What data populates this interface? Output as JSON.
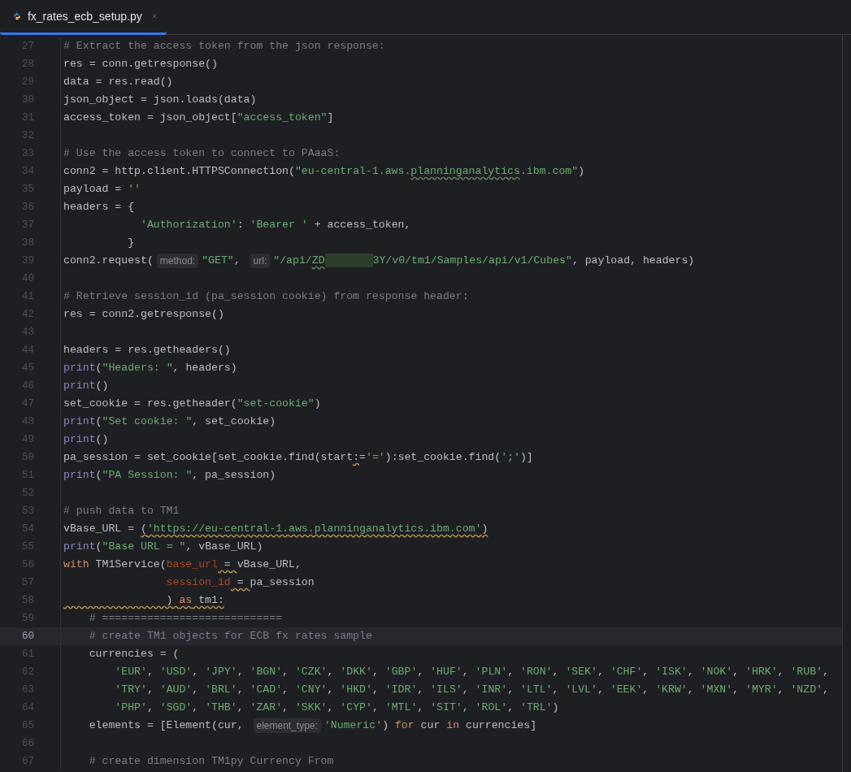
{
  "tab": {
    "title": "fx_rates_ecb_setup.py",
    "selected": true
  },
  "lines": [
    {
      "number": "27",
      "current": false,
      "tokens": [
        {
          "kind": "comment",
          "text": "# Extract the access token from the json response:"
        }
      ]
    },
    {
      "number": "28",
      "current": false,
      "tokens": [
        {
          "kind": "plain",
          "text": "res = conn.getresponse()"
        }
      ]
    },
    {
      "number": "29",
      "current": false,
      "tokens": [
        {
          "kind": "plain",
          "text": "data = res.read()"
        }
      ]
    },
    {
      "number": "30",
      "current": false,
      "tokens": [
        {
          "kind": "plain",
          "text": "json_object = json.loads(data)"
        }
      ]
    },
    {
      "number": "31",
      "current": false,
      "tokens": [
        {
          "kind": "plain",
          "text": "access_token = json_object["
        },
        {
          "kind": "string",
          "text": "\"access_token\""
        },
        {
          "kind": "plain",
          "text": "]"
        }
      ]
    },
    {
      "number": "32",
      "current": false
    },
    {
      "number": "33",
      "current": false,
      "tokens": [
        {
          "kind": "comment",
          "text": "# Use the access token to connect to PAaaS:"
        }
      ]
    },
    {
      "number": "34",
      "current": false,
      "tokens": [
        {
          "kind": "plain",
          "text": "conn2 = http.client.HTTPSConnection("
        },
        {
          "kind": "string",
          "text": "\"eu-central-1.aws."
        },
        {
          "kind": "string",
          "text": "planninganalytics",
          "misspelled": true
        },
        {
          "kind": "string",
          "text": ".ibm.com\""
        },
        {
          "kind": "plain",
          "text": ")"
        }
      ]
    },
    {
      "number": "35",
      "current": false,
      "tokens": [
        {
          "kind": "plain",
          "text": "payload = "
        },
        {
          "kind": "string",
          "text": "''"
        }
      ]
    },
    {
      "number": "36",
      "current": false,
      "tokens": [
        {
          "kind": "plain",
          "text": "headers = {"
        }
      ]
    },
    {
      "number": "37",
      "current": false,
      "tokens": [
        {
          "kind": "string",
          "text": "            'Authorization'"
        },
        {
          "kind": "plain",
          "text": ": "
        },
        {
          "kind": "string",
          "text": "'Bearer '"
        },
        {
          "kind": "plain",
          "text": " + access_token,"
        }
      ]
    },
    {
      "number": "38",
      "current": false,
      "tokens": [
        {
          "kind": "plain",
          "text": "          }"
        }
      ]
    },
    {
      "number": "39",
      "current": false,
      "tokens": [
        {
          "kind": "plain",
          "text": "conn2.request("
        },
        {
          "kind": "hint",
          "text": "method:"
        },
        {
          "kind": "string",
          "text": "\"GET\""
        },
        {
          "kind": "plain",
          "text": ", "
        },
        {
          "kind": "hint",
          "text": "url:"
        },
        {
          "kind": "string",
          "text": "\"/api/"
        },
        {
          "kind": "string",
          "text": "ZD",
          "misspelled": true
        },
        {
          "kind": "redacted"
        },
        {
          "kind": "string",
          "text": "3Y/v0/tm1/Samples/api/v1/Cubes\""
        },
        {
          "kind": "plain",
          "text": ", payload, headers)"
        }
      ]
    },
    {
      "number": "40",
      "current": false
    },
    {
      "number": "41",
      "current": false,
      "tokens": [
        {
          "kind": "comment",
          "text": "# Retrieve session_id (pa_session cookie) from response header:"
        }
      ]
    },
    {
      "number": "42",
      "current": false,
      "tokens": [
        {
          "kind": "plain",
          "text": "res = conn2.getresponse()"
        }
      ]
    },
    {
      "number": "43",
      "current": false
    },
    {
      "number": "44",
      "current": false,
      "tokens": [
        {
          "kind": "plain",
          "text": "headers = res.getheaders()"
        }
      ]
    },
    {
      "number": "45",
      "current": false,
      "tokens": [
        {
          "kind": "builtin",
          "text": "print"
        },
        {
          "kind": "plain",
          "text": "("
        },
        {
          "kind": "string",
          "text": "\"Headers: \""
        },
        {
          "kind": "plain",
          "text": ", headers)"
        }
      ]
    },
    {
      "number": "46",
      "current": false,
      "tokens": [
        {
          "kind": "builtin",
          "text": "print"
        },
        {
          "kind": "plain",
          "text": "()"
        }
      ]
    },
    {
      "number": "47",
      "current": false,
      "tokens": [
        {
          "kind": "plain",
          "text": "set_cookie = res.getheader("
        },
        {
          "kind": "string",
          "text": "\"set-cookie\""
        },
        {
          "kind": "plain",
          "text": ")"
        }
      ]
    },
    {
      "number": "48",
      "current": false,
      "tokens": [
        {
          "kind": "builtin",
          "text": "print"
        },
        {
          "kind": "plain",
          "text": "("
        },
        {
          "kind": "string",
          "text": "\"Set cookie: \""
        },
        {
          "kind": "plain",
          "text": ", set_cookie)"
        }
      ]
    },
    {
      "number": "49",
      "current": false,
      "tokens": [
        {
          "kind": "builtin",
          "text": "print"
        },
        {
          "kind": "plain",
          "text": "()"
        }
      ]
    },
    {
      "number": "50",
      "current": false,
      "tokens": [
        {
          "kind": "plain",
          "text": "pa_session = set_cookie[set_cookie.find(start"
        },
        {
          "kind": "plain",
          "text": ":",
          "warning": true
        },
        {
          "kind": "plain",
          "text": "="
        },
        {
          "kind": "string",
          "text": "'='"
        },
        {
          "kind": "plain",
          "text": "):set_cookie.find("
        },
        {
          "kind": "string",
          "text": "';'"
        },
        {
          "kind": "plain",
          "text": ")]"
        }
      ]
    },
    {
      "number": "51",
      "current": false,
      "tokens": [
        {
          "kind": "builtin",
          "text": "print"
        },
        {
          "kind": "plain",
          "text": "("
        },
        {
          "kind": "string",
          "text": "\"PA Session: \""
        },
        {
          "kind": "plain",
          "text": ", pa_session)"
        }
      ]
    },
    {
      "number": "52",
      "current": false
    },
    {
      "number": "53",
      "current": false,
      "tokens": [
        {
          "kind": "comment",
          "text": "# push data to TM1"
        }
      ]
    },
    {
      "number": "54",
      "current": false,
      "tokens": [
        {
          "kind": "plain",
          "text": "vBase_URL = "
        },
        {
          "kind": "plain",
          "text": "(",
          "warning": true
        },
        {
          "kind": "string",
          "text": "'https://eu-central-1.aws.planninganalytics.ibm.com'",
          "warning": true
        },
        {
          "kind": "plain",
          "text": ")",
          "warning": true
        }
      ]
    },
    {
      "number": "55",
      "current": false,
      "tokens": [
        {
          "kind": "builtin",
          "text": "print"
        },
        {
          "kind": "plain",
          "text": "("
        },
        {
          "kind": "string",
          "text": "\"Base URL = \""
        },
        {
          "kind": "plain",
          "text": ", vBase_URL)"
        }
      ]
    },
    {
      "number": "56",
      "current": false,
      "tokens": [
        {
          "kind": "keyword",
          "text": "with"
        },
        {
          "kind": "plain",
          "text": " TM1Service("
        },
        {
          "kind": "param",
          "text": "base_url"
        },
        {
          "kind": "plain",
          "text": " = ",
          "warning": true
        },
        {
          "kind": "plain",
          "text": "vBase_URL,"
        }
      ]
    },
    {
      "number": "57",
      "current": false,
      "tokens": [
        {
          "kind": "param",
          "text": "                session_id"
        },
        {
          "kind": "plain",
          "text": " = ",
          "warning": true
        },
        {
          "kind": "plain",
          "text": "pa_session"
        }
      ]
    },
    {
      "number": "58",
      "current": false,
      "tokens": [
        {
          "kind": "plain",
          "text": "                ) ",
          "warning": true
        },
        {
          "kind": "keyword",
          "text": "as",
          "warning": true
        },
        {
          "kind": "plain",
          "text": " tm1:",
          "warning": true
        }
      ]
    },
    {
      "number": "59",
      "current": false,
      "tokens": [
        {
          "kind": "comment",
          "text": "    # ============================"
        }
      ]
    },
    {
      "number": "60",
      "current": true,
      "tokens": [
        {
          "kind": "comment",
          "text": "    # create TM1 objects for ECB fx rates sample"
        }
      ]
    },
    {
      "number": "61",
      "current": false,
      "tokens": [
        {
          "kind": "plain",
          "text": "    currencies = ("
        }
      ]
    },
    {
      "number": "62",
      "current": false,
      "tokens": [
        {
          "kind": "string",
          "text": "        'EUR'"
        },
        {
          "kind": "plain",
          "text": ", "
        },
        {
          "kind": "string",
          "text": "'USD'"
        },
        {
          "kind": "plain",
          "text": ", "
        },
        {
          "kind": "string",
          "text": "'JPY'"
        },
        {
          "kind": "plain",
          "text": ", "
        },
        {
          "kind": "string",
          "text": "'BGN'"
        },
        {
          "kind": "plain",
          "text": ", "
        },
        {
          "kind": "string",
          "text": "'CZK'"
        },
        {
          "kind": "plain",
          "text": ", "
        },
        {
          "kind": "string",
          "text": "'DKK'"
        },
        {
          "kind": "plain",
          "text": ", "
        },
        {
          "kind": "string",
          "text": "'GBP'"
        },
        {
          "kind": "plain",
          "text": ", "
        },
        {
          "kind": "string",
          "text": "'HUF'"
        },
        {
          "kind": "plain",
          "text": ", "
        },
        {
          "kind": "string",
          "text": "'PLN'"
        },
        {
          "kind": "plain",
          "text": ", "
        },
        {
          "kind": "string",
          "text": "'RON'"
        },
        {
          "kind": "plain",
          "text": ", "
        },
        {
          "kind": "string",
          "text": "'SEK'"
        },
        {
          "kind": "plain",
          "text": ", "
        },
        {
          "kind": "string",
          "text": "'CHF'"
        },
        {
          "kind": "plain",
          "text": ", "
        },
        {
          "kind": "string",
          "text": "'ISK'"
        },
        {
          "kind": "plain",
          "text": ", "
        },
        {
          "kind": "string",
          "text": "'NOK'"
        },
        {
          "kind": "plain",
          "text": ", "
        },
        {
          "kind": "string",
          "text": "'HRK'"
        },
        {
          "kind": "plain",
          "text": ", "
        },
        {
          "kind": "string",
          "text": "'RUB'"
        },
        {
          "kind": "plain",
          "text": ","
        }
      ]
    },
    {
      "number": "63",
      "current": false,
      "tokens": [
        {
          "kind": "string",
          "text": "        'TRY'"
        },
        {
          "kind": "plain",
          "text": ", "
        },
        {
          "kind": "string",
          "text": "'AUD'"
        },
        {
          "kind": "plain",
          "text": ", "
        },
        {
          "kind": "string",
          "text": "'BRL'"
        },
        {
          "kind": "plain",
          "text": ", "
        },
        {
          "kind": "string",
          "text": "'CAD'"
        },
        {
          "kind": "plain",
          "text": ", "
        },
        {
          "kind": "string",
          "text": "'CNY'"
        },
        {
          "kind": "plain",
          "text": ", "
        },
        {
          "kind": "string",
          "text": "'HKD'"
        },
        {
          "kind": "plain",
          "text": ", "
        },
        {
          "kind": "string",
          "text": "'IDR'"
        },
        {
          "kind": "plain",
          "text": ", "
        },
        {
          "kind": "string",
          "text": "'ILS'"
        },
        {
          "kind": "plain",
          "text": ", "
        },
        {
          "kind": "string",
          "text": "'INR'"
        },
        {
          "kind": "plain",
          "text": ", "
        },
        {
          "kind": "string",
          "text": "'LTL'"
        },
        {
          "kind": "plain",
          "text": ", "
        },
        {
          "kind": "string",
          "text": "'LVL'"
        },
        {
          "kind": "plain",
          "text": ", "
        },
        {
          "kind": "string",
          "text": "'EEK'"
        },
        {
          "kind": "plain",
          "text": ", "
        },
        {
          "kind": "string",
          "text": "'KRW'"
        },
        {
          "kind": "plain",
          "text": ", "
        },
        {
          "kind": "string",
          "text": "'MXN'"
        },
        {
          "kind": "plain",
          "text": ", "
        },
        {
          "kind": "string",
          "text": "'MYR'"
        },
        {
          "kind": "plain",
          "text": ", "
        },
        {
          "kind": "string",
          "text": "'NZD'"
        },
        {
          "kind": "plain",
          "text": ","
        }
      ]
    },
    {
      "number": "64",
      "current": false,
      "tokens": [
        {
          "kind": "string",
          "text": "        'PHP'"
        },
        {
          "kind": "plain",
          "text": ", "
        },
        {
          "kind": "string",
          "text": "'SGD'"
        },
        {
          "kind": "plain",
          "text": ", "
        },
        {
          "kind": "string",
          "text": "'THB'"
        },
        {
          "kind": "plain",
          "text": ", "
        },
        {
          "kind": "string",
          "text": "'ZAR'"
        },
        {
          "kind": "plain",
          "text": ", "
        },
        {
          "kind": "string",
          "text": "'SKK'"
        },
        {
          "kind": "plain",
          "text": ", "
        },
        {
          "kind": "string",
          "text": "'CYP'"
        },
        {
          "kind": "plain",
          "text": ", "
        },
        {
          "kind": "string",
          "text": "'MTL'"
        },
        {
          "kind": "plain",
          "text": ", "
        },
        {
          "kind": "string",
          "text": "'SIT'"
        },
        {
          "kind": "plain",
          "text": ", "
        },
        {
          "kind": "string",
          "text": "'ROL'"
        },
        {
          "kind": "plain",
          "text": ", "
        },
        {
          "kind": "string",
          "text": "'TRL'"
        },
        {
          "kind": "plain",
          "text": ")"
        }
      ]
    },
    {
      "number": "65",
      "current": false,
      "tokens": [
        {
          "kind": "plain",
          "text": "    elements = [Element(cur, "
        },
        {
          "kind": "hint",
          "text": "element_type:"
        },
        {
          "kind": "string",
          "text": "'Numeric'"
        },
        {
          "kind": "plain",
          "text": ") "
        },
        {
          "kind": "keyword",
          "text": "for"
        },
        {
          "kind": "plain",
          "text": " cur "
        },
        {
          "kind": "keyword",
          "text": "in"
        },
        {
          "kind": "plain",
          "text": " currencies]"
        }
      ]
    },
    {
      "number": "66",
      "current": false
    },
    {
      "number": "67",
      "current": false,
      "tokens": [
        {
          "kind": "comment",
          "text": "    # create dimension TM1py Currency From"
        }
      ]
    }
  ]
}
